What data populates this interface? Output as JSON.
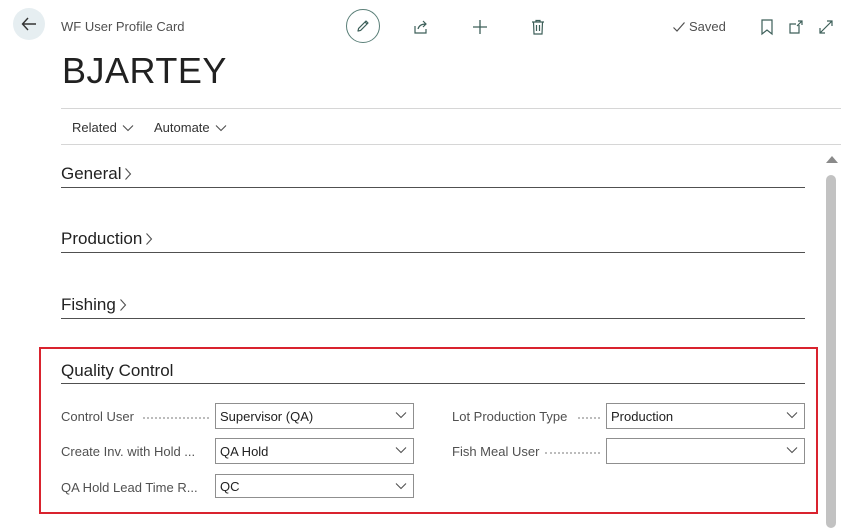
{
  "header": {
    "breadcrumb": "WF User Profile Card",
    "saved_label": "Saved",
    "record_title": "BJARTEY"
  },
  "actions": {
    "related_label": "Related",
    "automate_label": "Automate"
  },
  "sections": {
    "general": "General",
    "production": "Production",
    "fishing": "Fishing",
    "quality_control": "Quality Control"
  },
  "quality_control": {
    "control_user_label": "Control User",
    "control_user_value": "Supervisor (QA)",
    "create_inv_label": "Create Inv. with Hold ...",
    "create_inv_value": "QA Hold",
    "qa_hold_lead_label": "QA Hold Lead Time R...",
    "qa_hold_lead_value": "QC",
    "lot_production_type_label": "Lot Production Type",
    "lot_production_type_value": "Production",
    "fish_meal_user_label": "Fish Meal User",
    "fish_meal_user_value": ""
  },
  "colors": {
    "accent": "#5a7f78",
    "highlight_border": "#d9232e"
  }
}
